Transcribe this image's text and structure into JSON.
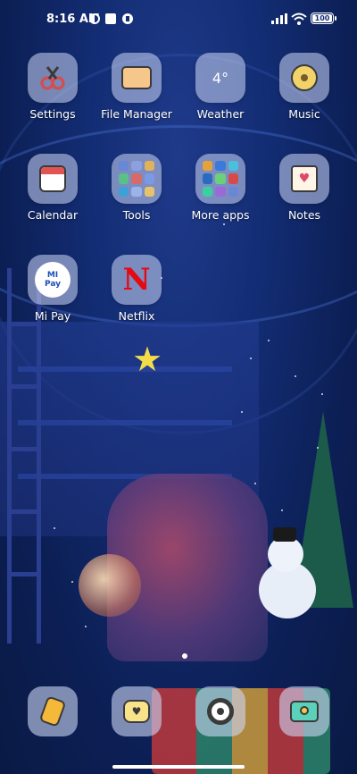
{
  "status_bar": {
    "time": "8:16 AM",
    "battery": "100",
    "icons": [
      "dnd-icon",
      "square-notification-icon",
      "circle-notification-icon",
      "signal-icon",
      "wifi-icon",
      "battery-icon"
    ]
  },
  "apps": [
    {
      "label": "Settings",
      "icon": "settings-icon"
    },
    {
      "label": "File Manager",
      "icon": "folder-icon"
    },
    {
      "label": "Weather",
      "icon": "weather-icon",
      "value": "4°"
    },
    {
      "label": "Music",
      "icon": "music-disc-icon"
    },
    {
      "label": "Calendar",
      "icon": "calendar-icon"
    },
    {
      "label": "Tools",
      "icon": "folder-grid-icon"
    },
    {
      "label": "More apps",
      "icon": "folder-grid-icon"
    },
    {
      "label": "Notes",
      "icon": "notes-heart-icon"
    },
    {
      "label": "Mi Pay",
      "icon": "mi-pay-icon",
      "badge_top": "MI",
      "badge_bottom": "Pay"
    },
    {
      "label": "Netflix",
      "icon": "netflix-icon",
      "glyph": "N"
    }
  ],
  "dock": [
    {
      "icon": "phone-icon"
    },
    {
      "icon": "messages-icon"
    },
    {
      "icon": "chrome-icon"
    },
    {
      "icon": "camera-icon"
    }
  ],
  "page_indicator": {
    "pages": 1,
    "current": 1
  },
  "colors": {
    "wallpaper": "#132d74",
    "tile": "#cdd7f5",
    "netflix": "#e50914"
  }
}
